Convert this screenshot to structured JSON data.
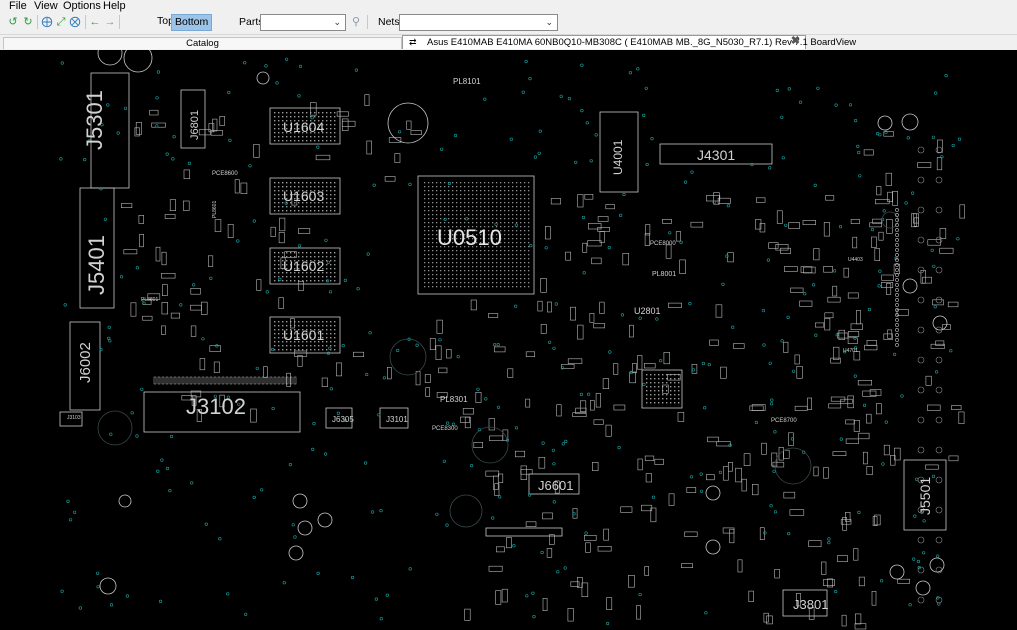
{
  "menu": {
    "file": "File",
    "view": "View",
    "options": "Options",
    "help": "Help"
  },
  "toolbar": {
    "icons": [
      "rotate-left-icon",
      "rotate-right-icon",
      "zoom-in-icon",
      "zoom-fit-icon",
      "zoom-out-icon",
      "back-arrow-icon",
      "forward-arrow-icon"
    ],
    "top_label": "Top",
    "bottom_label": "Bottom",
    "bottom_active": true,
    "parts_label": "Parts:",
    "parts_value": "",
    "nets_label": "Nets:",
    "nets_value": ""
  },
  "tabs": {
    "catalog": "Catalog",
    "board": "Asus E410MAB E410MA  60NB0Q10-MB308C  ( E410MAB MB._8G_N5030_R7.1) Rev 7.1 BoardView"
  },
  "board": {
    "background": "#000000",
    "outline_color": "#c8c8c8",
    "via_color": "#1aa3a3",
    "parts": {
      "j5301": "J5301",
      "j6801": "J6801",
      "u1604": "U1604",
      "u1603": "U1603",
      "u1602": "U1602",
      "u1601": "U1601",
      "j5401": "J5401",
      "j6002": "J6002",
      "j3102": "J3102",
      "j6305": "J6305",
      "j3101": "J3101",
      "u0510": "U0510",
      "u4001": "U4001",
      "j4301": "J4301",
      "pl8101": "PL8101",
      "pl8301": "PL8301",
      "pce8600": "PCE8600",
      "pce8300": "PCE8300",
      "pce8700": "PCE8700",
      "pl8801": "PL8801",
      "pl8601": "PL8601",
      "pce8000": "PCE8000",
      "pl8001": "PL8001",
      "u2801": "U2801",
      "j6601": "J6601",
      "j5501": "J5501",
      "j3801": "J3801",
      "u4403": "U4403",
      "u4701": "U4701",
      "j3103": "J3103"
    }
  }
}
